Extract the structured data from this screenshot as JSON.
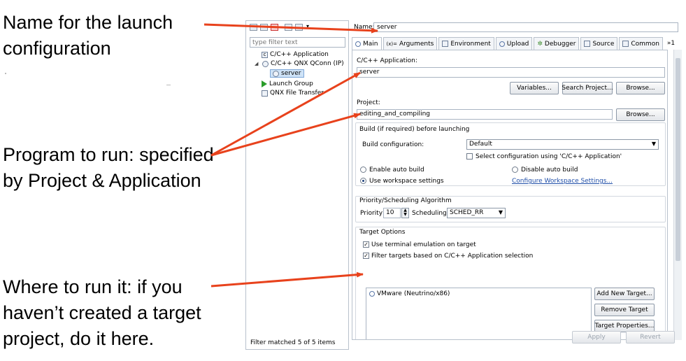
{
  "annotations": {
    "name": "Name for the launch configuration",
    "program": "Program to run: specified by Project & Application",
    "where": "Where to run it: if you haven’t created a target project, do it here."
  },
  "left_pane": {
    "filter_placeholder": "type filter text",
    "tree": {
      "cpp_application": "C/C++ Application",
      "qnx_qconn": "C/C++ QNX QConn (IP)",
      "server": "server",
      "launch_group": "Launch Group",
      "qnx_file_transfer": "QNX File Transfer"
    },
    "status": "Filter matched 5 of 5 items"
  },
  "config": {
    "name_label": "Name:",
    "name_value": "server",
    "tabs": [
      "Main",
      "Arguments",
      "Environment",
      "Upload",
      "Debugger",
      "Source",
      "Common",
      "»1"
    ],
    "cpp_app_label": "C/C++ Application:",
    "cpp_app_value": "server",
    "variables_btn": "Variables...",
    "search_project_btn": "Search Project...",
    "browse_btn": "Browse...",
    "project_label": "Project:",
    "project_value": "editing_and_compiling",
    "build_group_title": "Build (if required) before launching",
    "build_config_label": "Build configuration:",
    "build_config_value": "Default",
    "select_config_label": "Select configuration using 'C/C++ Application'",
    "enable_auto_build": "Enable auto build",
    "disable_auto_build": "Disable auto build",
    "use_workspace_settings": "Use workspace settings",
    "configure_workspace_link": "Configure Workspace Settings...",
    "priority_group_title": "Priority/Scheduling Algorithm",
    "priority_label": "Priority",
    "priority_value": "10",
    "scheduling_label": "Scheduling",
    "scheduling_value": "SCHED_RR",
    "target_group_title": "Target Options",
    "use_terminal_emulation": "Use terminal emulation on target",
    "filter_targets": "Filter targets based on C/C++ Application selection",
    "target_item": "VMware (Neutrino/x86)",
    "add_target_btn": "Add New Target...",
    "remove_target_btn": "Remove Target",
    "target_props_btn": "Target Properties...",
    "apply_btn": "Apply",
    "revert_btn": "Revert"
  }
}
